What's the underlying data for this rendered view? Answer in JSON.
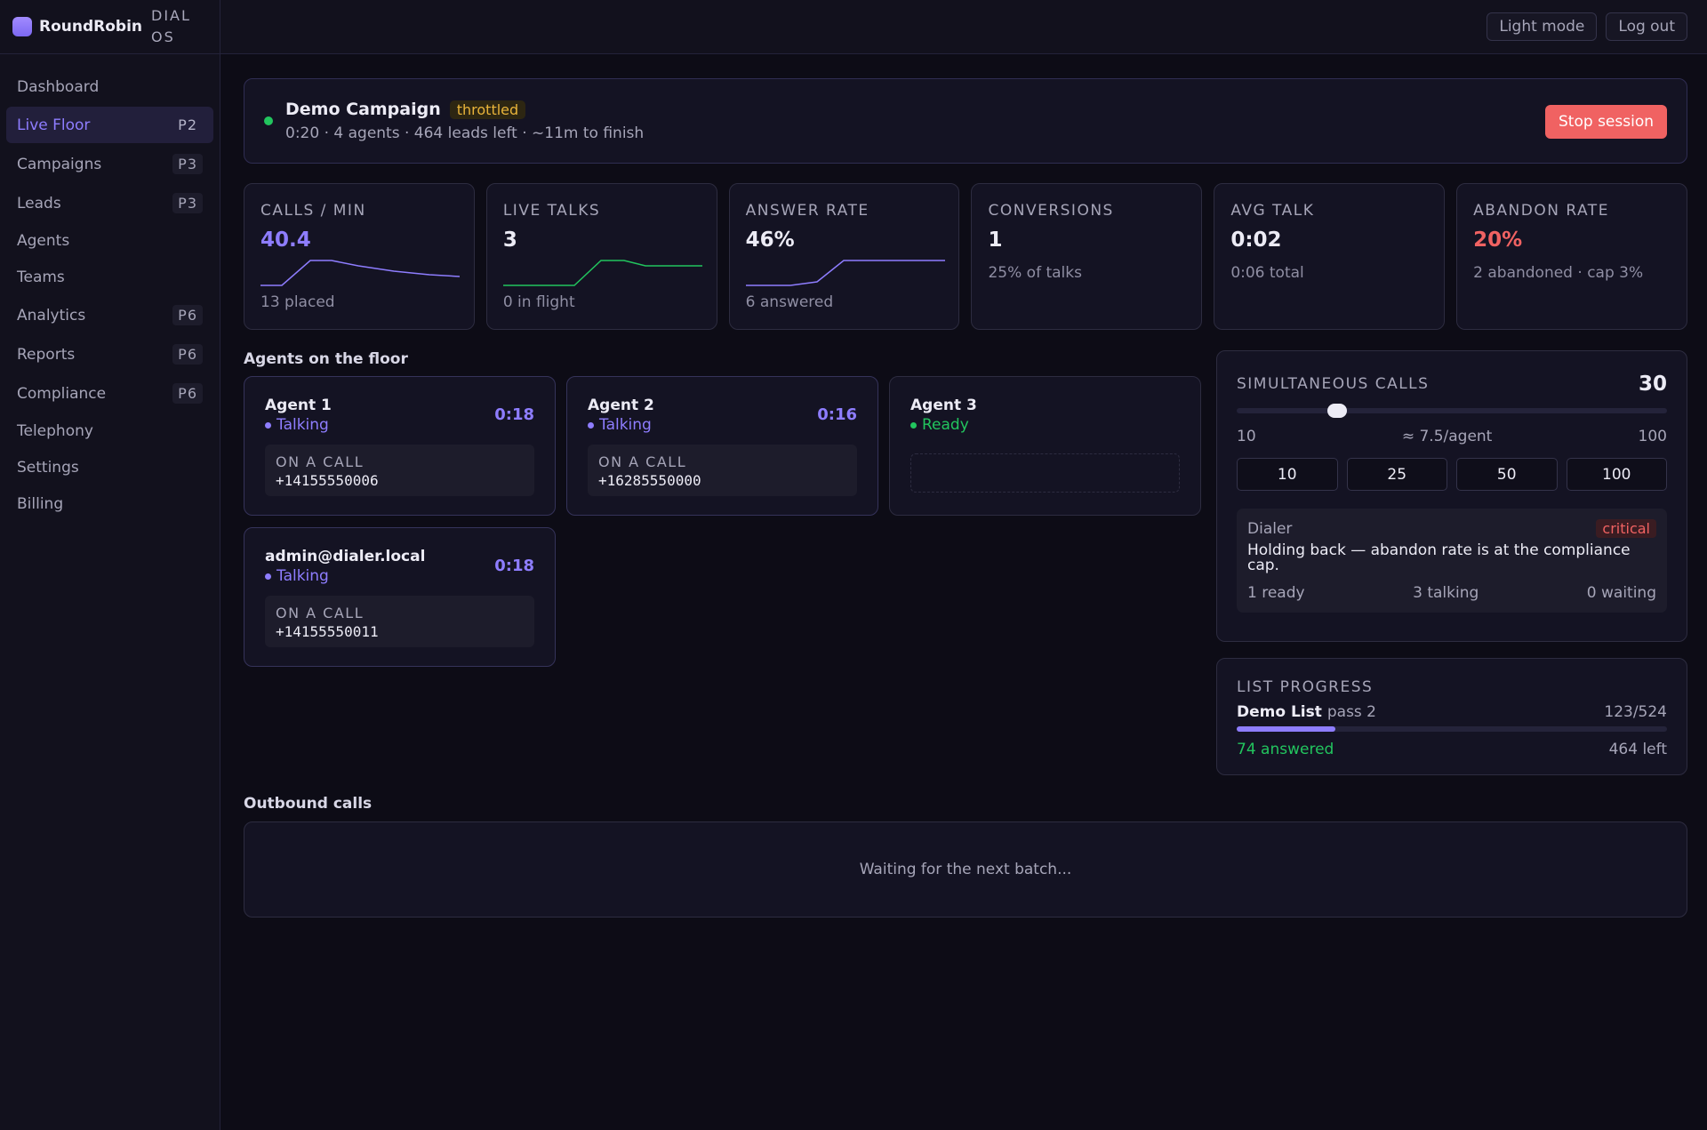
{
  "brand": {
    "name": "RoundRobin",
    "sub": "DIAL OS"
  },
  "nav": [
    {
      "label": "Dashboard",
      "badge": ""
    },
    {
      "label": "Live Floor",
      "badge": "P2",
      "active": true
    },
    {
      "label": "Campaigns",
      "badge": "P3"
    },
    {
      "label": "Leads",
      "badge": "P3"
    },
    {
      "label": "Agents",
      "badge": ""
    },
    {
      "label": "Teams",
      "badge": ""
    },
    {
      "label": "Analytics",
      "badge": "P6"
    },
    {
      "label": "Reports",
      "badge": "P6"
    },
    {
      "label": "Compliance",
      "badge": "P6"
    },
    {
      "label": "Telephony",
      "badge": ""
    },
    {
      "label": "Settings",
      "badge": ""
    },
    {
      "label": "Billing",
      "badge": ""
    }
  ],
  "topbar": {
    "light_mode": "Light mode",
    "logout": "Log out"
  },
  "campaign": {
    "name": "Demo Campaign",
    "status": "throttled",
    "meta": "0:20 · 4 agents · 464 leads left · ~11m to finish",
    "stop_label": "Stop session"
  },
  "stats": [
    {
      "label": "CALLS / MIN",
      "value": "40.4",
      "sub": "13 placed"
    },
    {
      "label": "LIVE TALKS",
      "value": "3",
      "sub": "0 in flight"
    },
    {
      "label": "ANSWER RATE",
      "value": "46%",
      "sub": "6 answered"
    },
    {
      "label": "CONVERSIONS",
      "value": "1",
      "sub": "25% of talks"
    },
    {
      "label": "AVG TALK",
      "value": "0:02",
      "sub": "0:06 total"
    },
    {
      "label": "ABANDON RATE",
      "value": "20%",
      "sub": "2 abandoned · cap 3%"
    }
  ],
  "colors": {
    "accent": "#8e7dff",
    "green": "#22c55e",
    "red": "#f06262",
    "amber": "#e8b33a"
  },
  "agents_title": "Agents on the floor",
  "agents": [
    {
      "name": "Agent 1",
      "status": "Talking",
      "time": "0:18",
      "call_label": "ON A CALL",
      "number": "+14155550006"
    },
    {
      "name": "Agent 2",
      "status": "Talking",
      "time": "0:16",
      "call_label": "ON A CALL",
      "number": "+16285550000"
    },
    {
      "name": "Agent 3",
      "status": "Ready",
      "time": "",
      "call_label": "",
      "number": ""
    },
    {
      "name": "admin@dialer.local",
      "status": "Talking",
      "time": "0:18",
      "call_label": "ON A CALL",
      "number": "+14155550011"
    }
  ],
  "simultaneous": {
    "label": "SIMULTANEOUS CALLS",
    "value": "30",
    "min": "10",
    "max": "100",
    "per_agent": "≈ 7.5/agent",
    "presets": [
      "10",
      "25",
      "50",
      "100"
    ]
  },
  "dialer": {
    "label": "Dialer",
    "badge": "critical",
    "message": "Holding back — abandon rate is at the compliance cap.",
    "ready": "1 ready",
    "talking": "3 talking",
    "waiting": "0 waiting"
  },
  "list_progress": {
    "label": "LIST PROGRESS",
    "name": "Demo List",
    "pass": "pass 2",
    "count": "123/524",
    "progress": 0.23,
    "answered": "74 answered",
    "left": "464 left"
  },
  "outbound": {
    "title": "Outbound calls",
    "empty": "Waiting for the next batch..."
  }
}
